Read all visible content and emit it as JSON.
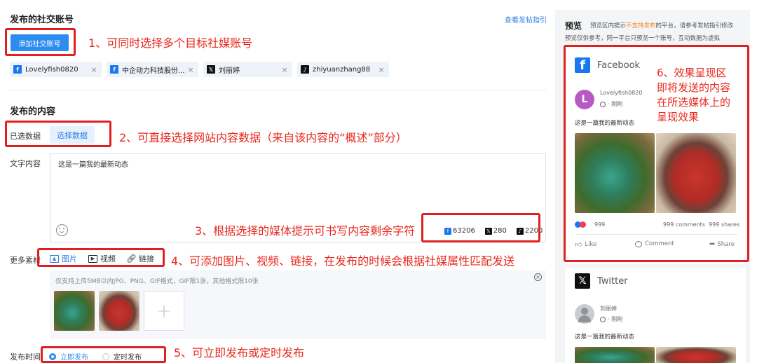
{
  "header": {
    "section_accounts_title": "发布的社交账号",
    "guide_link": "查看发帖指引"
  },
  "accounts": {
    "add_button": "添加社交账号",
    "chips": [
      {
        "platform": "facebook",
        "icon": "facebook-icon",
        "label": "Lovelyfish0820"
      },
      {
        "platform": "facebook",
        "icon": "facebook-icon",
        "label": "中企动力科技股份..."
      },
      {
        "platform": "x",
        "icon": "x-icon",
        "label": "刘丽婷"
      },
      {
        "platform": "tiktok",
        "icon": "tiktok-icon",
        "label": "zhiyuanzhang88"
      }
    ],
    "close_glyph": "×"
  },
  "content": {
    "section_title": "发布的内容",
    "selected_data_label": "已选数据",
    "select_data_button": "选择数据",
    "text_label": "文字内容",
    "text_value": "这是一篇我的最新动态",
    "char_counts": [
      {
        "platform": "facebook",
        "icon": "facebook-icon",
        "value": "63206"
      },
      {
        "platform": "x",
        "icon": "x-icon",
        "value": "280"
      },
      {
        "platform": "tiktok",
        "icon": "tiktok-icon",
        "value": "2200"
      }
    ],
    "more_media_label": "更多素材",
    "media_options": [
      {
        "icon": "image-icon",
        "label": "图片"
      },
      {
        "icon": "video-icon",
        "label": "视频"
      },
      {
        "icon": "link-icon",
        "label": "链接"
      }
    ],
    "upload_hint": "仅支持上传5MB以内JPG、PNG、GIF格式，GIF限1张，其他格式限10张",
    "add_glyph": "+"
  },
  "publish": {
    "time_label": "发布时间",
    "options": [
      {
        "label": "立即发布",
        "selected": true
      },
      {
        "label": "定时发布",
        "selected": false
      }
    ]
  },
  "annotations": {
    "a1": "1、可同时选择多个目标社媒账号",
    "a2": "2、可直接选择网站内容数据（来自该内容的“概述”部分）",
    "a3": "3、根据选择的媒体提示可书写内容剩余字符",
    "a4": "4、可添加图片、视频、链接，在发布的时候会根据社媒属性匹配发送",
    "a5": "5、可立即发布或定时发布",
    "a6_lines": [
      "6、效果呈现区",
      "即将发送的内容",
      "在所选媒体上的",
      "呈现效果"
    ]
  },
  "preview": {
    "title": "预览",
    "notice_pre": "预览区内提示",
    "notice_highlight": "不支持发布",
    "notice_post": "的平台，请参考发帖指引修改",
    "notice_line2": "预览仅供参考，同一平台只预览一个账号，互动数据为虚拟",
    "facebook": {
      "platform_name": "Facebook",
      "avatar_letter": "L",
      "account": "Lovelyfish0820",
      "time": "· 刚刚",
      "post_text": "这是一篇我的最新动态",
      "reactions": "999",
      "comments": "999 comments",
      "shares": "999 shares",
      "actions": [
        "Like",
        "Comment",
        "Share"
      ]
    },
    "twitter": {
      "platform_name": "Twitter",
      "account": "刘丽婷",
      "time": "· 刚刚",
      "post_text": "这是一篇我的最新动态"
    }
  },
  "colors": {
    "accent": "#2d8cf0",
    "annotation_red": "#e02020",
    "warning_orange": "#f5821f",
    "facebook_blue": "#1877f2"
  }
}
